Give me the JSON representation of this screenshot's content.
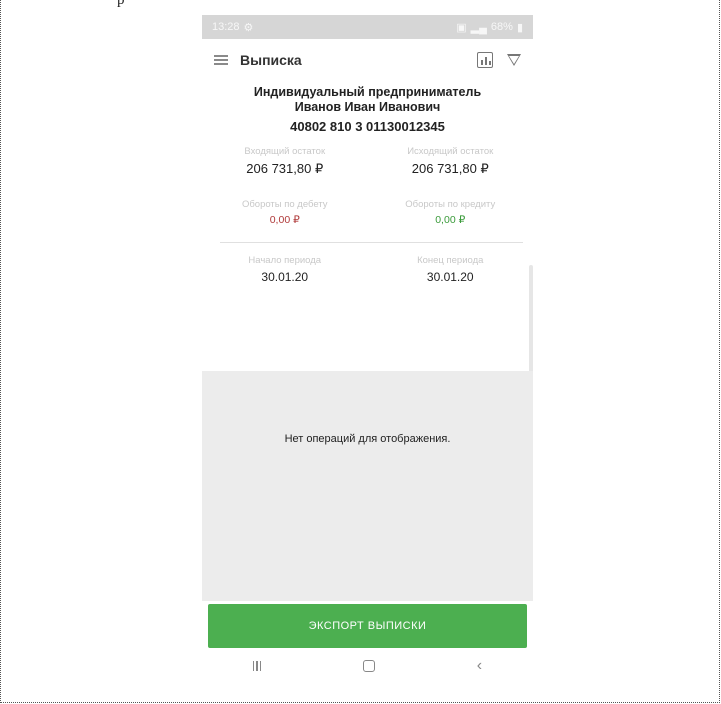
{
  "status_bar": {
    "time": "13:28",
    "battery": "68%"
  },
  "app_bar": {
    "title": "Выписка"
  },
  "company": {
    "line1": "Индивидуальный предприниматель",
    "line2": "Иванов Иван Иванович",
    "account": "40802 810 3 01130012345"
  },
  "balances": {
    "opening_label": "Входящий остаток",
    "opening_value": "206 731,80 ₽",
    "closing_label": "Исходящий остаток",
    "closing_value": "206 731,80 ₽"
  },
  "turnovers": {
    "debit_label": "Обороты по дебету",
    "debit_value": "0,00 ₽",
    "credit_label": "Обороты по кредиту",
    "credit_value": "0,00 ₽"
  },
  "period": {
    "start_label": "Начало периода",
    "start_value": "30.01.20",
    "end_label": "Конец периода",
    "end_value": "30.01.20"
  },
  "empty_message": "Нет операций для отображения.",
  "export_button": "ЭКСПОРТ ВЫПИСКИ",
  "colors": {
    "accent": "#4caf50",
    "debit": "#b03a3a",
    "credit": "#3b9b3b"
  }
}
